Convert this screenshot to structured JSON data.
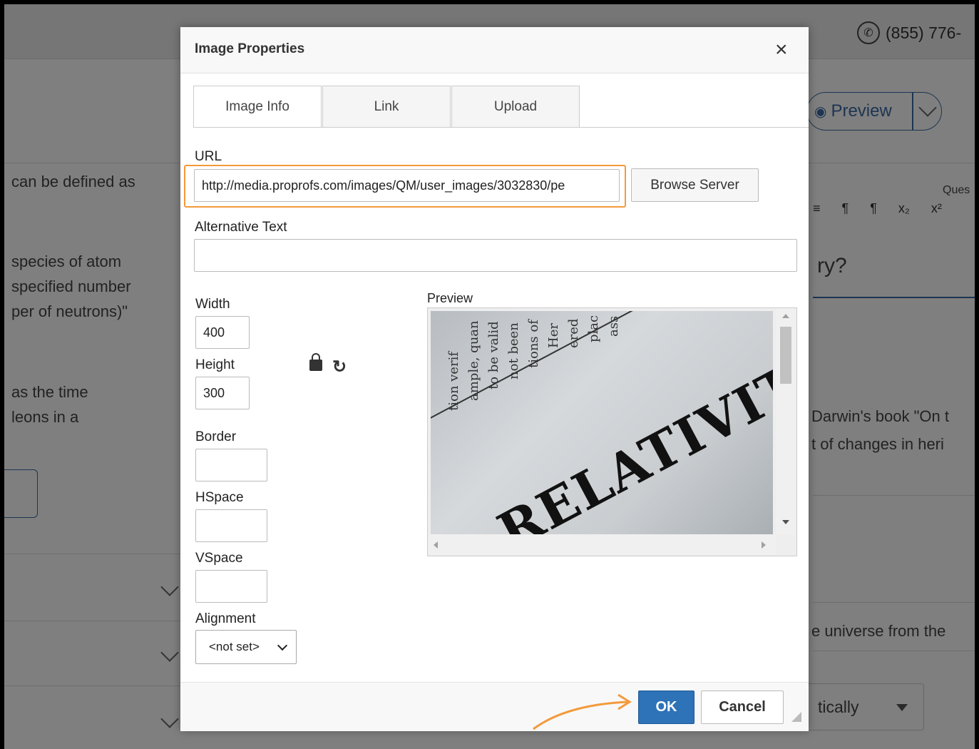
{
  "background": {
    "phone": "(855) 776-",
    "preview_button": "Preview",
    "question_label": "Ques",
    "left_texts": [
      "can be defined as",
      "species of atom",
      "specified number",
      "per of neutrons)\"",
      "as the time",
      "leons in a"
    ],
    "right_texts": [
      "ry?",
      "Darwin's book \"On t",
      "t of changes in heri",
      "e universe from the"
    ],
    "dropdown_text": "tically",
    "toolbar_symbols": [
      "≡",
      "¶",
      "¶",
      "x₂",
      "x²"
    ]
  },
  "dialog": {
    "title": "Image Properties",
    "close_symbol": "×",
    "tabs": [
      {
        "label": "Image Info",
        "active": true
      },
      {
        "label": "Link",
        "active": false
      },
      {
        "label": "Upload",
        "active": false
      }
    ],
    "url_label": "URL",
    "url_value": "http://media.proprofs.com/images/QM/user_images/3032830/pe",
    "browse_button": "Browse Server",
    "alt_label": "Alternative Text",
    "alt_value": "",
    "width_label": "Width",
    "width_value": "400",
    "height_label": "Height",
    "height_value": "300",
    "border_label": "Border",
    "border_value": "",
    "hspace_label": "HSpace",
    "hspace_value": "",
    "vspace_label": "VSpace",
    "vspace_value": "",
    "alignment_label": "Alignment",
    "alignment_value": "<not set>",
    "preview_label": "Preview",
    "preview_image_word": "RELATIVITY",
    "preview_image_lines": [
      "tion verif",
      "ample, quan",
      "to be valid",
      "not been",
      "tions of",
      "Her",
      "ered",
      "plac",
      "ass"
    ],
    "ok_button": "OK",
    "cancel_button": "Cancel"
  },
  "colors": {
    "highlight": "#f39a3c",
    "ok_blue": "#2e72b8",
    "link_blue": "#3b6ba5"
  }
}
